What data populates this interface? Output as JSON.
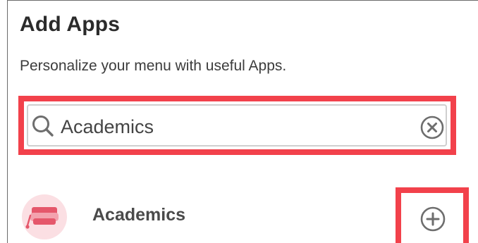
{
  "panel": {
    "title": "Add Apps",
    "subtitle": "Personalize your menu with useful Apps."
  },
  "search": {
    "value": "Academics",
    "search_icon": "search-icon",
    "clear_icon": "clear-circle-icon"
  },
  "results": [
    {
      "name": "Academics",
      "icon": "graduation-cap-icon",
      "action_icon": "add-circle-icon"
    }
  ],
  "colors": {
    "highlight": "#f2414b",
    "app_icon_bg": "#fbdfe3",
    "app_icon_fg": "#e5576b",
    "icon_gray": "#6e6e6e",
    "text_dark": "#2b2b2b"
  }
}
